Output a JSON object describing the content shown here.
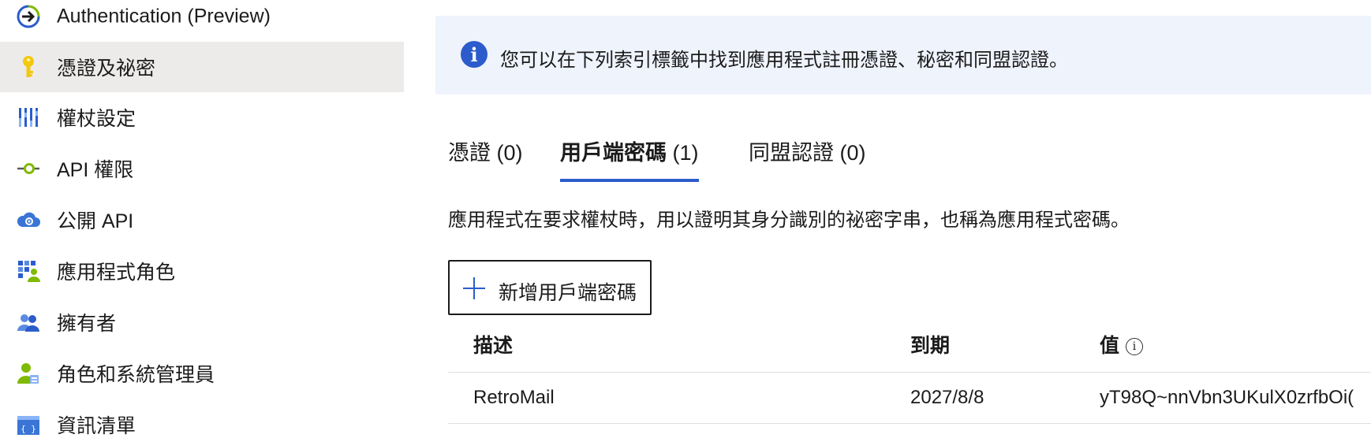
{
  "sidebar": {
    "items": [
      {
        "label": "Authentication (Preview)",
        "icon": "authentication-arrow-icon",
        "active": false
      },
      {
        "label": "憑證及祕密",
        "icon": "key-icon",
        "active": true
      },
      {
        "label": "權杖設定",
        "icon": "token-bars-icon",
        "active": false
      },
      {
        "label": "API 權限",
        "icon": "api-permission-icon",
        "active": false
      },
      {
        "label": "公開 API",
        "icon": "cloud-api-icon",
        "active": false
      },
      {
        "label": "應用程式角色",
        "icon": "app-roles-grid-icon",
        "active": false
      },
      {
        "label": "擁有者",
        "icon": "owners-users-icon",
        "active": false
      },
      {
        "label": "角色和系統管理員",
        "icon": "roles-admins-icon",
        "active": false
      },
      {
        "label": "資訊清單",
        "icon": "manifest-icon",
        "active": false
      }
    ]
  },
  "main": {
    "info_banner": {
      "text": "您可以在下列索引標籤中找到應用程式註冊憑證、秘密和同盟認證。",
      "icon_text": "i"
    },
    "tabs": [
      {
        "name": "憑證",
        "count": "(0)",
        "selected": false
      },
      {
        "name": "用戶端密碼",
        "count": "(1)",
        "selected": true
      },
      {
        "name": "同盟認證",
        "count": "(0)",
        "selected": false
      }
    ],
    "tab_description": "應用程式在要求權杖時，用以證明其身分識別的祕密字串，也稱為應用程式密碼。",
    "add_button_label": "新增用戶端密碼",
    "table": {
      "headers": {
        "description": "描述",
        "expires": "到期",
        "value": "值"
      },
      "value_info_icon": "i",
      "rows": [
        {
          "description": "RetroMail",
          "expires": "2027/8/8",
          "value": "yT98Q~nnVbn3UKulX0zrfbOi("
        }
      ]
    }
  },
  "colors": {
    "accent": "#2c5ccc",
    "active_nav_bg": "#edebe9",
    "banner_bg": "#eff3fc",
    "key_yellow": "#f2c811",
    "divider": "#e1dfdd"
  }
}
